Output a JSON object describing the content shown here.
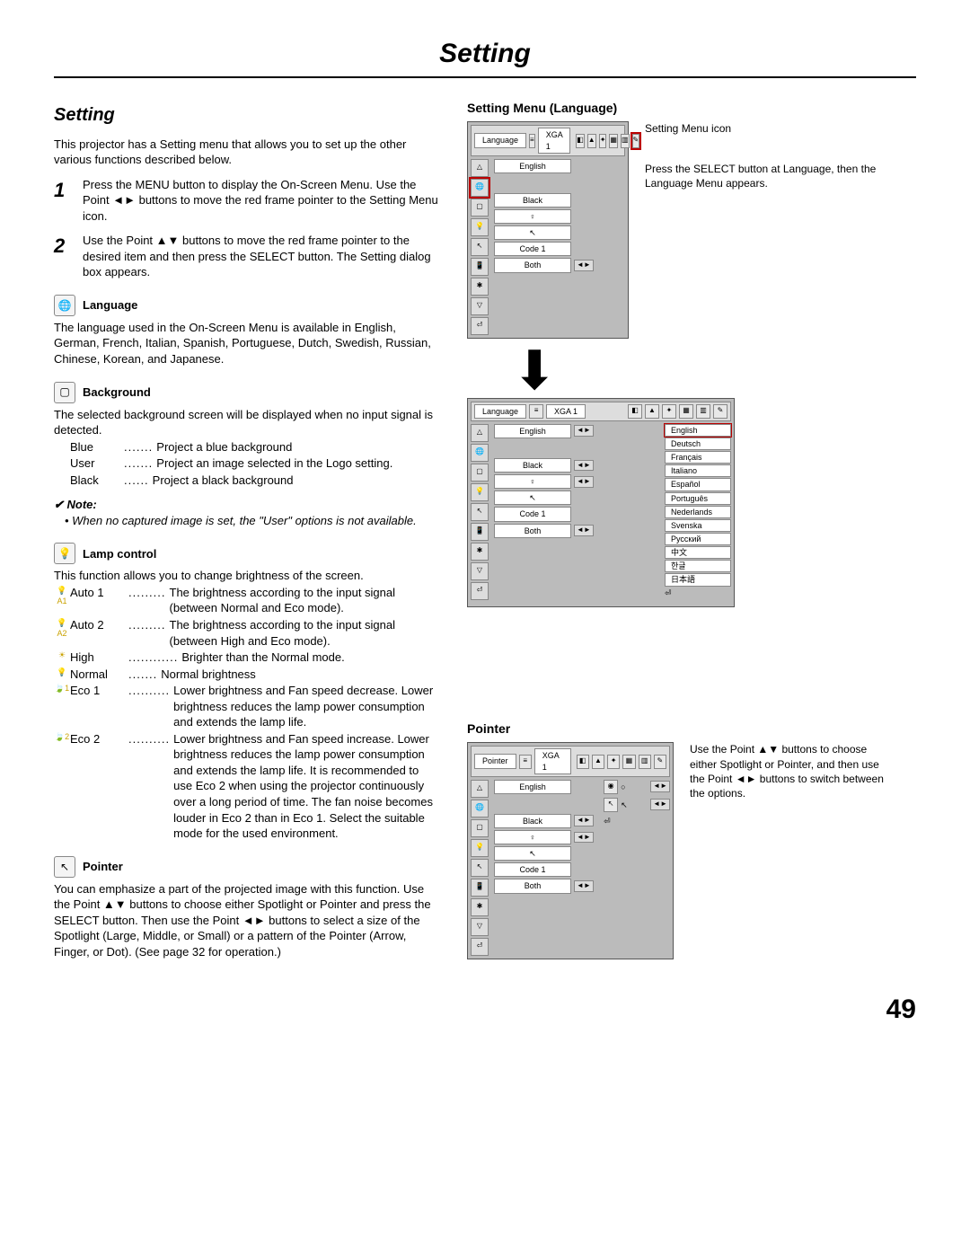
{
  "page": {
    "title_main": "Setting",
    "section_title": "Setting",
    "page_num": "49"
  },
  "intro": "This projector has a Setting menu that allows you to set up the other various functions described below.",
  "steps": {
    "s1_num": "1",
    "s1_txt": "Press the MENU button to display the On-Screen Menu. Use the Point ◄► buttons to move the red frame pointer to the Setting Menu icon.",
    "s2_num": "2",
    "s2_txt": "Use the Point ▲▼ buttons to move the red frame pointer to the desired item and then press the SELECT button. The Setting dialog box appears."
  },
  "language": {
    "heading": "Language",
    "body": "The language used in the On-Screen Menu is available in English, German, French, Italian, Spanish, Portuguese, Dutch, Swedish, Russian, Chinese, Korean, and Japanese."
  },
  "background": {
    "heading": "Background",
    "body": "The selected background screen will be displayed when no input signal is detected.",
    "opts": {
      "blue_l": "Blue",
      "blue_v": "Project a blue background",
      "user_l": "User",
      "user_v": "Project an image selected in the Logo setting.",
      "black_l": "Black",
      "black_v": "Project a black background"
    },
    "note_hdr": "✔ Note:",
    "note_body": "• When no captured image is set, the \"User\" options is not available."
  },
  "lamp": {
    "heading": "Lamp control",
    "body": "This function allows you to change brightness of the screen.",
    "rows": {
      "a1_l": "Auto 1",
      "a1_v": "The brightness according to the input signal (between Normal and Eco mode).",
      "a2_l": "Auto 2",
      "a2_v": "The brightness according to the input signal (between High and Eco mode).",
      "hi_l": "High",
      "hi_v": "Brighter than the Normal mode.",
      "no_l": "Normal",
      "no_v": "Normal brightness",
      "e1_l": "Eco 1",
      "e1_v": "Lower brightness and Fan speed decrease. Lower brightness reduces the lamp power consumption and extends the lamp life.",
      "e2_l": "Eco 2",
      "e2_v": "Lower brightness and Fan speed increase. Lower brightness reduces the lamp power consumption and extends the lamp life. It is recommended to use Eco 2 when using the projector continuously over a long period of time. The fan noise becomes louder in Eco 2 than in Eco 1. Select the suitable mode for the used environment."
    }
  },
  "pointer": {
    "heading": "Pointer",
    "body": "You can emphasize a part of the projected image with this function. Use the Point ▲▼ buttons to choose either Spotlight or Pointer and press the SELECT button. Then use the Point ◄► buttons to select a size of the Spotlight (Large, Middle, or Small) or a pattern of the Pointer (Arrow, Finger, or Dot). (See page 32 for operation.)"
  },
  "right": {
    "h1": "Setting Menu (Language)",
    "h2": "Pointer",
    "callout1": "Setting Menu icon",
    "callout2": "Press the SELECT button at Language, then the Language Menu appears.",
    "callout3": "Use the Point ▲▼ buttons to choose either Spotlight or Pointer, and then use the Point ◄► buttons to switch between the options.",
    "mb": {
      "tab_lang": "Language",
      "tab_ptr": "Pointer",
      "tab_mode": "XGA 1",
      "v_english": "English",
      "v_black": "Black",
      "v_lamp": "♀",
      "v_ptr": "↖",
      "v_code": "Code 1",
      "v_both": "Both"
    },
    "langs": {
      "l0": "English",
      "l1": "Deutsch",
      "l2": "Français",
      "l3": "Italiano",
      "l4": "Español",
      "l5": "Português",
      "l6": "Nederlands",
      "l7": "Svenska",
      "l8": "Русский",
      "l9": "中文",
      "l10": "한글",
      "l11": "日本語"
    }
  }
}
